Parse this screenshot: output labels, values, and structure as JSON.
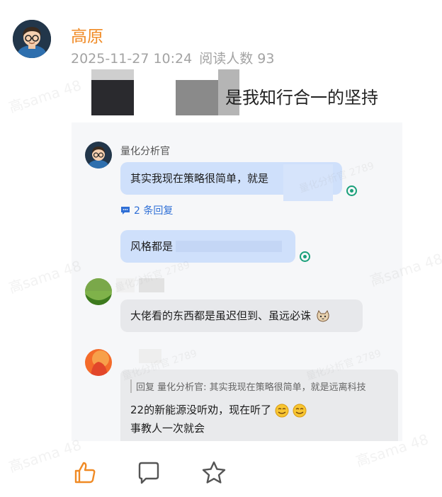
{
  "post": {
    "author": "高原",
    "date": "2025-11-27 10:24",
    "reads_label": "阅读人数 93",
    "text_visible": "是我知行合一的坚持"
  },
  "screenshot": {
    "comment1": {
      "name": "量化分析官",
      "bubble1": "其实我现在策略很简单，就是",
      "reply_count": "2 条回复",
      "bubble2": "风格都是"
    },
    "comment2": {
      "bubble": "大佬看的东西都是虽迟但到、虽远必诛"
    },
    "comment3": {
      "quote": "回复 量化分析官: 其实我现在策略很简单，就是远离科技",
      "body_line1": "22的新能源没听劝，现在听了",
      "body_line2": "事教人一次就会"
    },
    "watermark": "量化分析官 2789"
  },
  "watermark_page": "高sama 48",
  "actions": {
    "like": "thumbs-up-icon",
    "comment": "comment-icon",
    "favorite": "star-icon"
  },
  "colors": {
    "author": "#f08a24",
    "meta": "#a3a3a3",
    "bubble_blue": "#cfe0fb",
    "bubble_grey": "#e7e8eb",
    "link": "#2f6fd6",
    "read_dot": "#1aa07a"
  }
}
